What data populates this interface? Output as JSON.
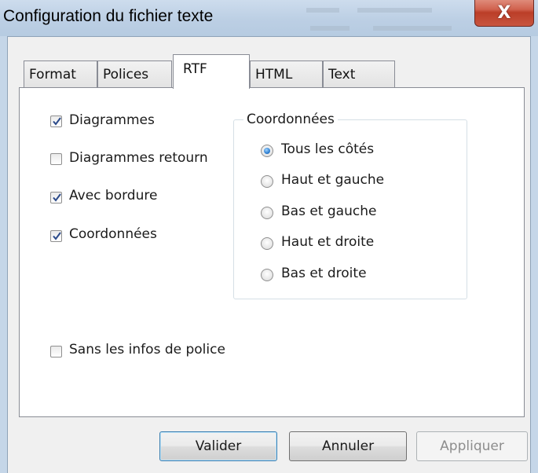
{
  "window": {
    "title": "Configuration du fichier texte",
    "close_label": "X"
  },
  "tabs": [
    {
      "label": "Format",
      "active": false
    },
    {
      "label": "Polices",
      "active": false
    },
    {
      "label": "RTF",
      "active": true
    },
    {
      "label": "HTML",
      "active": false
    },
    {
      "label": "Text",
      "active": false
    }
  ],
  "checkboxes": [
    {
      "label": "Diagrammes",
      "checked": true
    },
    {
      "label": "Diagrammes retourn",
      "checked": false
    },
    {
      "label": "Avec bordure",
      "checked": true
    },
    {
      "label": "Coordonnées",
      "checked": true
    },
    {
      "label": "Sans les infos de police",
      "checked": false
    }
  ],
  "coordinates_group": {
    "title": "Coordonnées",
    "options": [
      {
        "label": "Tous les côtés",
        "selected": true
      },
      {
        "label": "Haut et gauche",
        "selected": false
      },
      {
        "label": "Bas et gauche",
        "selected": false
      },
      {
        "label": "Haut et droite",
        "selected": false
      },
      {
        "label": "Bas et droite",
        "selected": false
      }
    ]
  },
  "buttons": {
    "ok": "Valider",
    "cancel": "Annuler",
    "apply": "Appliquer"
  },
  "colors": {
    "accent": "#3c7fb1",
    "close_button": "#c8553f",
    "titlebar": "#bccfe4"
  }
}
